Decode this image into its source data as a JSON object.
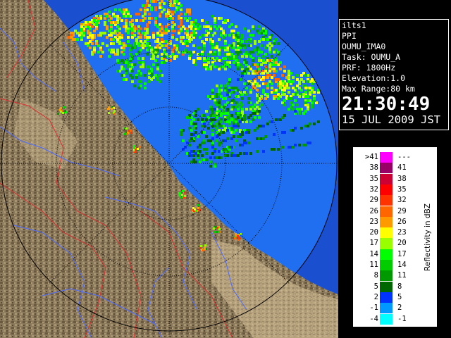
{
  "info": {
    "station": "ilts1",
    "scan_type": "PPI",
    "product": "OUMU_IMA0",
    "task": "Task: OUMU_A",
    "prf": "PRF: 1800Hz",
    "elevation": "Elevation:1.0",
    "max_range": "Max Range:80 km",
    "time": "21:30:49",
    "date": "15 JUL 2009 JST"
  },
  "legend": {
    "unit_label": "Reflectivity in dBZ",
    "rows": [
      {
        "lo": ">41",
        "hi": "---",
        "color": "#ff00ff"
      },
      {
        "lo": "38",
        "hi": "41",
        "color": "#990066"
      },
      {
        "lo": "35",
        "hi": "38",
        "color": "#cc0033"
      },
      {
        "lo": "32",
        "hi": "35",
        "color": "#ff0000"
      },
      {
        "lo": "29",
        "hi": "32",
        "color": "#ff3300"
      },
      {
        "lo": "26",
        "hi": "29",
        "color": "#ff6600"
      },
      {
        "lo": "23",
        "hi": "26",
        "color": "#ff9900"
      },
      {
        "lo": "20",
        "hi": "23",
        "color": "#ffff00"
      },
      {
        "lo": "17",
        "hi": "20",
        "color": "#99ff00"
      },
      {
        "lo": "14",
        "hi": "17",
        "color": "#00ff00"
      },
      {
        "lo": "11",
        "hi": "14",
        "color": "#00cc00"
      },
      {
        "lo": "8",
        "hi": "11",
        "color": "#009900"
      },
      {
        "lo": "5",
        "hi": "8",
        "color": "#006600"
      },
      {
        "lo": "2",
        "hi": "5",
        "color": "#0033ff"
      },
      {
        "lo": "-1",
        "hi": "2",
        "color": "#0099ff"
      },
      {
        "lo": "-4",
        "hi": "-1",
        "color": "#00ffff"
      }
    ]
  },
  "map": {
    "sea_color": "#1a66e6",
    "sea_outer_color": "#0d4fc8",
    "land_color": "#8a7656",
    "land_dark_color": "#5a4a32",
    "river_color": "#4d6bff",
    "border_color": "#d03030",
    "grid_color": "#000000"
  }
}
